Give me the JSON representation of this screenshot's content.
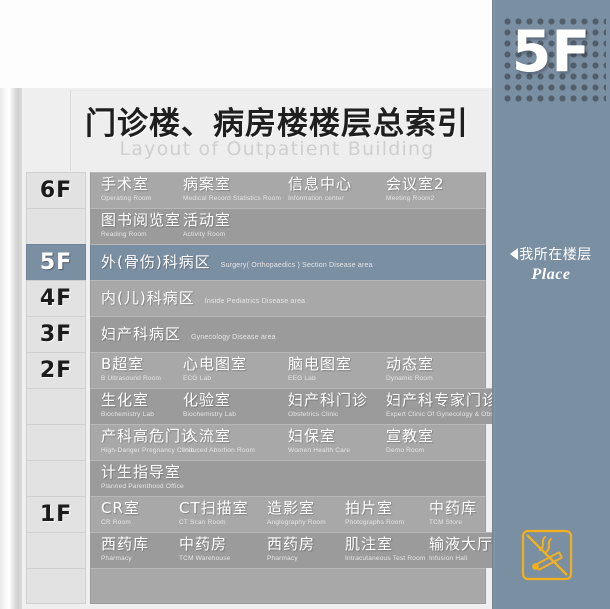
{
  "title": {
    "cn": "门诊楼、病房楼楼层总索引",
    "en": "Layout of Outpatient Building"
  },
  "right_panel": {
    "current_floor": "5F",
    "place_cn": "我所在楼层",
    "place_en": "Place",
    "logo_icon": "no-smoking-icon",
    "accent_color": "#7b8fa3",
    "logo_color": "#f2b01e"
  },
  "rows": [
    {
      "floor": "6F",
      "active": false,
      "shade": "light",
      "layout": "columns",
      "cells": [
        {
          "cn": "手术室",
          "en": "Operating Room"
        },
        {
          "cn": "病案室",
          "en": "Medical Record Statistics Room"
        },
        {
          "cn": "信息中心",
          "en": "Information center"
        },
        {
          "cn": "会议室2",
          "en": "Meeting Room2"
        }
      ]
    },
    {
      "floor": "",
      "active": false,
      "shade": "dark",
      "layout": "columns",
      "cells": [
        {
          "cn": "图书阅览室",
          "en": "Reading Room"
        },
        {
          "cn": "活动室",
          "en": "Activity Room"
        }
      ]
    },
    {
      "floor": "5F",
      "active": true,
      "shade": "active",
      "layout": "inline",
      "cells": [
        {
          "cn": "外(骨伤)科病区",
          "en": "Surgery( Orthopaedics ) Section Disease  area"
        }
      ]
    },
    {
      "floor": "4F",
      "active": false,
      "shade": "light",
      "layout": "inline",
      "cells": [
        {
          "cn": "内(儿)科病区",
          "en": "Inside Pediatrics Disease area"
        }
      ]
    },
    {
      "floor": "3F",
      "active": false,
      "shade": "dark",
      "layout": "inline",
      "cells": [
        {
          "cn": "妇产科病区",
          "en": "Gynecology Disease area"
        }
      ]
    },
    {
      "floor": "2F",
      "active": false,
      "shade": "light",
      "layout": "columns",
      "cells": [
        {
          "cn": "B超室",
          "en": "B Ultrasound Room"
        },
        {
          "cn": "心电图室",
          "en": "ECG Lab"
        },
        {
          "cn": "脑电图室",
          "en": "EEG Lab"
        },
        {
          "cn": "动态室",
          "en": "Dynamic Room"
        }
      ]
    },
    {
      "floor": "",
      "active": false,
      "shade": "dark",
      "layout": "columns",
      "cells": [
        {
          "cn": "生化室",
          "en": "Biochemistry Lab"
        },
        {
          "cn": "化验室",
          "en": "Biochemistry Lab"
        },
        {
          "cn": "妇产科门诊",
          "en": "Obstetrics Clinic"
        },
        {
          "cn": "妇产科专家门诊",
          "en": "Expert Clinic Of Gynecology & Obstetrics"
        }
      ]
    },
    {
      "floor": "",
      "active": false,
      "shade": "light",
      "layout": "columns",
      "cells": [
        {
          "cn": "产科高危门诊",
          "en": "High-Danger Pregnancy Clinic"
        },
        {
          "cn": "人流室",
          "en": "Induced Abortion Room"
        },
        {
          "cn": "妇保室",
          "en": "Women Health Care"
        },
        {
          "cn": "宣教室",
          "en": "Demo Room"
        }
      ]
    },
    {
      "floor": "",
      "active": false,
      "shade": "dark",
      "layout": "columns",
      "cells": [
        {
          "cn": "计生指导室",
          "en": "Planned Parenthood Office"
        }
      ]
    },
    {
      "floor": "1F",
      "active": false,
      "shade": "light",
      "layout": "columns5",
      "cells": [
        {
          "cn": "CR室",
          "en": "CR Room"
        },
        {
          "cn": "CT扫描室",
          "en": "CT Scan Room"
        },
        {
          "cn": "造影室",
          "en": "Anglography Room"
        },
        {
          "cn": "拍片室",
          "en": "Photographs Room"
        },
        {
          "cn": "中药库",
          "en": "TCM Store"
        }
      ]
    },
    {
      "floor": "",
      "active": false,
      "shade": "dark",
      "layout": "columns5",
      "cells": [
        {
          "cn": "西药库",
          "en": "Pharmacy"
        },
        {
          "cn": "中药房",
          "en": "TCM Warehouse"
        },
        {
          "cn": "西药房",
          "en": "Pharmacy"
        },
        {
          "cn": "肌注室",
          "en": "Intracutaneous Test Room"
        },
        {
          "cn": "输液大厅",
          "en": "Infusion Hall"
        }
      ]
    },
    {
      "floor": "",
      "active": false,
      "shade": "light",
      "layout": "columns",
      "cells": []
    }
  ]
}
